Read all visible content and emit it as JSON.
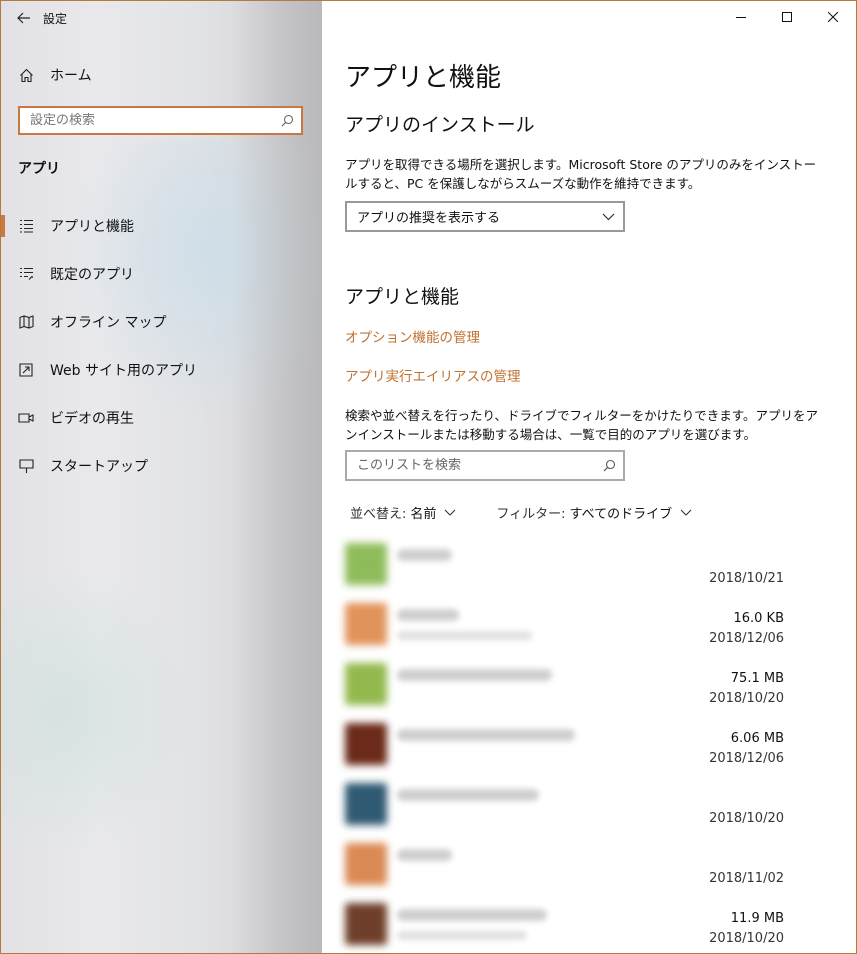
{
  "window": {
    "title": "設定"
  },
  "sidebar": {
    "home_label": "ホーム",
    "search_placeholder": "設定の検索",
    "section_label": "アプリ",
    "items": [
      {
        "label": "アプリと機能",
        "icon": "apps-features-icon",
        "selected": true
      },
      {
        "label": "既定のアプリ",
        "icon": "default-apps-icon",
        "selected": false
      },
      {
        "label": "オフライン マップ",
        "icon": "offline-maps-icon",
        "selected": false
      },
      {
        "label": "Web サイト用のアプリ",
        "icon": "apps-for-websites-icon",
        "selected": false
      },
      {
        "label": "ビデオの再生",
        "icon": "video-playback-icon",
        "selected": false
      },
      {
        "label": "スタートアップ",
        "icon": "startup-icon",
        "selected": false
      }
    ]
  },
  "main": {
    "title": "アプリと機能",
    "install_heading": "アプリのインストール",
    "install_desc": "アプリを取得できる場所を選択します。Microsoft Store のアプリのみをインストールすると、PC を保護しながらスムーズな動作を維持できます。",
    "install_dropdown": "アプリの推奨を表示する",
    "apps_heading": "アプリと機能",
    "link_optional": "オプション機能の管理",
    "link_alias": "アプリ実行エイリアスの管理",
    "apps_desc": "検索や並べ替えを行ったり、ドライブでフィルターをかけたりできます。アプリをアンインストールまたは移動する場合は、一覧で目的のアプリを選びます。",
    "list_search_placeholder": "このリストを検索",
    "sort_label": "並べ替え:",
    "sort_value": "名前",
    "filter_label": "フィルター:",
    "filter_value": "すべてのドライブ"
  },
  "apps": [
    {
      "size": "",
      "date": "2018/10/21",
      "icon_color": "#8fbc5a"
    },
    {
      "size": "16.0 KB",
      "date": "2018/12/06",
      "icon_color": "#e0935a"
    },
    {
      "size": "75.1 MB",
      "date": "2018/10/20",
      "icon_color": "#93b94e"
    },
    {
      "size": "6.06 MB",
      "date": "2018/12/06",
      "icon_color": "#6b2a1a"
    },
    {
      "size": "",
      "date": "2018/10/20",
      "icon_color": "#2f5a73"
    },
    {
      "size": "",
      "date": "2018/11/02",
      "icon_color": "#d98a55"
    },
    {
      "size": "11.9 MB",
      "date": "2018/10/20",
      "icon_color": "#6e3f2a"
    }
  ]
}
